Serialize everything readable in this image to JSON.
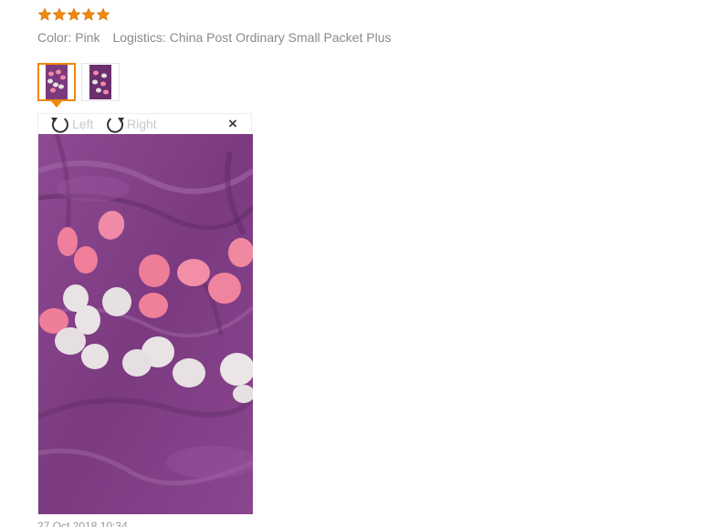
{
  "review": {
    "rating": 5,
    "star_color": "#f0880c",
    "color_label": "Color: Pink",
    "logistics_label": "Logistics: China Post Ordinary Small Packet Plus",
    "date_partial": "27 Oct 2018 10:34"
  },
  "thumbnails": [
    {
      "label": "photo-1",
      "selected": true
    },
    {
      "label": "photo-2",
      "selected": false
    }
  ],
  "viewer": {
    "rotate_left_label": "Left",
    "rotate_right_label": "Right",
    "close_glyph": "×",
    "icons": {
      "rotate_left": "rotate-left-icon",
      "rotate_right": "rotate-right-icon",
      "close": "close-icon"
    }
  },
  "colors": {
    "accent": "#f0880c",
    "fabric": "#8c3f8c",
    "petal_pink": "#f08aa6",
    "petal_white": "#e8e1e3"
  }
}
